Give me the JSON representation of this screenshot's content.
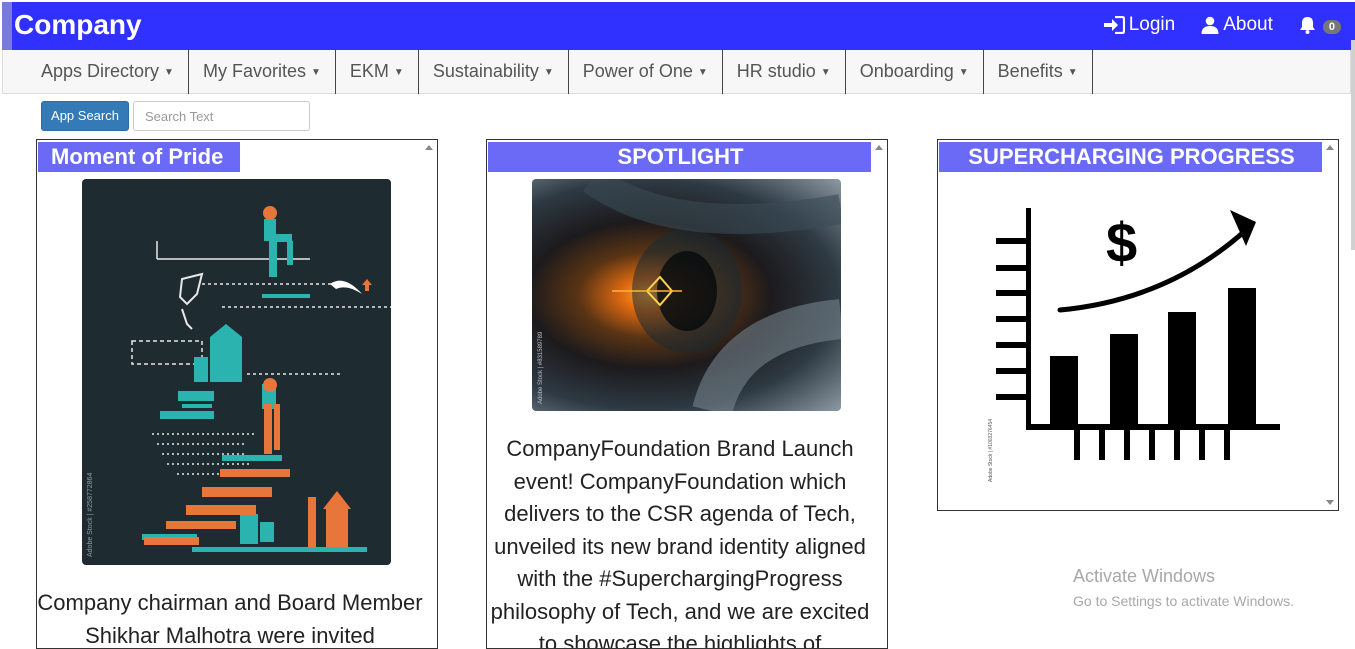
{
  "header": {
    "brand": "Company",
    "login_label": "Login",
    "about_label": "About",
    "notification_count": "0"
  },
  "menu": {
    "items": [
      {
        "label": "Apps Directory"
      },
      {
        "label": "My Favorites"
      },
      {
        "label": "EKM"
      },
      {
        "label": "Sustainability"
      },
      {
        "label": "Power of One"
      },
      {
        "label": "HR studio"
      },
      {
        "label": "Onboarding"
      },
      {
        "label": "Benefits"
      }
    ]
  },
  "search": {
    "button_label": "App Search",
    "placeholder": "Search Text",
    "value": ""
  },
  "panels": {
    "pride": {
      "title": "Moment of Pride",
      "text": "Company chairman and Board Member Shikhar Malhotra were invited",
      "image_stock_id": "Adobe Stock | #258772864"
    },
    "spotlight": {
      "title": "SPOTLIGHT",
      "text": "CompanyFoundation Brand Launch event! CompanyFoundation which delivers to the CSR agenda of Tech, unveiled its new brand identity aligned with the #SuperchargingProgress philosophy of Tech, and we are excited to showcase the highlights of",
      "image_stock_id": "Adobe Stock | #831589789"
    },
    "progress": {
      "title": "SUPERCHARGING PROGRESS",
      "image_stock_id": "Adobe Stock | #1003276454",
      "currency_symbol": "$"
    }
  },
  "os_watermark": {
    "line1": "Activate Windows",
    "line2": "Go to Settings to activate Windows."
  },
  "colors": {
    "topbar": "#3030ff",
    "panel_title": "#6a6af7",
    "search_button": "#337ab7"
  }
}
